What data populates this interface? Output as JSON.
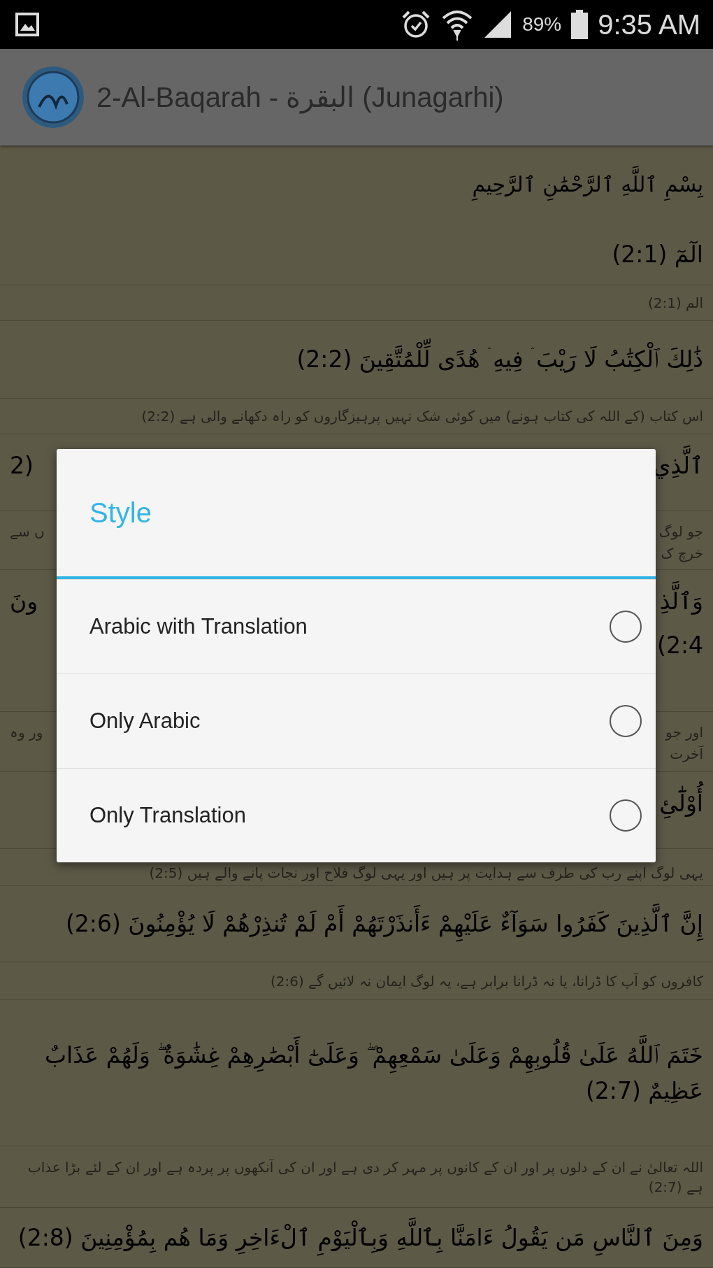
{
  "status_bar": {
    "battery": "89%",
    "time": "9:35 AM"
  },
  "app_bar": {
    "title": "2-Al-Baqarah - البقرة  (Junagarhi)"
  },
  "verses": [
    {
      "kind": "bismillah",
      "text": "بِسْمِ ٱللَّهِ ٱلرَّحْمَٰنِ ٱلرَّحِيمِ"
    },
    {
      "kind": "arabic",
      "text": "الٓمٓ (2:1)"
    },
    {
      "kind": "translation",
      "text": "الم (2:1)"
    },
    {
      "kind": "arabic",
      "text": "ذَٰلِكَ ٱلْكِتَٰبُ لَا رَيْبَ ۛ فِيهِ ۛ هُدًى لِّلْمُتَّقِينَ (2:2)"
    },
    {
      "kind": "translation",
      "text": "اس کتاب (کے اللہ کی کتاب ہونے) میں کوئی شک نہیں پرہیزگاروں کو راہ دکھانے والی ہے (2:2)"
    },
    {
      "kind": "arabic-partial",
      "right": [
        "ٱلَّذِي"
      ],
      "left": [
        "(2"
      ]
    },
    {
      "kind": "translation-partial",
      "right": [
        "جو لوگ",
        "خرچ ک"
      ],
      "left": [
        "ں سے"
      ]
    },
    {
      "kind": "arabic-partial",
      "right": [
        "وَٱلَّذِ",
        "2:4)"
      ],
      "left": [
        "ونَ"
      ]
    },
    {
      "kind": "translation-partial",
      "right": [
        "اور جو",
        "آخرت"
      ],
      "left": [
        "ور وہ"
      ]
    },
    {
      "kind": "arabic-partial",
      "right": [
        "أُوْلَٰٓئِ"
      ]
    },
    {
      "kind": "translation",
      "text": "یہی لوگ اپنے رب کی طرف سے ہدایت پر ہیں اور یہی لوگ فلاح اور نجات پانے والے ہیں (2:5)"
    },
    {
      "kind": "arabic",
      "text": "إِنَّ ٱلَّذِينَ كَفَرُوا سَوَآءٌ عَلَيْهِمْ ءَأَنذَرْتَهُمْ أَمْ لَمْ تُنذِرْهُمْ لَا يُؤْمِنُونَ (2:6)"
    },
    {
      "kind": "translation",
      "text": "کافروں کو آپ کا ڈرانا، یا نہ ڈرانا برابر ہے، یہ لوگ ایمان نہ لائیں گے (2:6)"
    },
    {
      "kind": "arabic",
      "text": "خَتَمَ ٱللَّهُ عَلَىٰ قُلُوبِهِمْ وَعَلَىٰ سَمْعِهِمْ ۖ وَعَلَىٰٓ أَبْصَٰرِهِمْ غِشَٰوَةٌ ۖ وَلَهُمْ عَذَابٌ عَظِيمٌ (2:7)"
    },
    {
      "kind": "translation",
      "text": "اللہ تعالیٰ نے ان کے دلوں پر اور ان کے کانوں پر مہر کر دی ہے اور ان کی آنکھوں پر پردہ ہے اور ان کے لئے بڑا عذاب ہے (2:7)"
    },
    {
      "kind": "arabic",
      "text": "وَمِنَ ٱلنَّاسِ مَن يَقُولُ ءَامَنَّا بِٱللَّهِ وَبِٱلْيَوْمِ ٱلْءَاخِرِ وَمَا هُم بِمُؤْمِنِينَ (2:8)"
    }
  ],
  "dialog": {
    "title": "Style",
    "options": [
      {
        "label": "Arabic with Translation",
        "selected": false
      },
      {
        "label": "Only Arabic",
        "selected": false
      },
      {
        "label": "Only Translation",
        "selected": false
      }
    ]
  }
}
